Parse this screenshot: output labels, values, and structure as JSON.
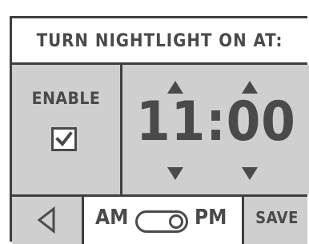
{
  "header": {
    "title": "TURN NIGHTLIGHT ON AT:"
  },
  "enable": {
    "label": "ENABLE",
    "checked": true
  },
  "time": {
    "value": "11:00"
  },
  "footer": {
    "am_label": "AM",
    "pm_label": "PM",
    "selected_period": "PM",
    "save_label": "SAVE"
  },
  "icons": {
    "back": "back-triangle-icon",
    "hour_up": "triangle-up-icon",
    "hour_down": "triangle-down-icon",
    "minute_up": "triangle-up-icon",
    "minute_down": "triangle-down-icon",
    "check": "checkmark-icon"
  },
  "colors": {
    "panel": "#cfcfcf",
    "border": "#3f3f3f",
    "text": "#4a4a4a",
    "highlight": "#ffffff"
  }
}
